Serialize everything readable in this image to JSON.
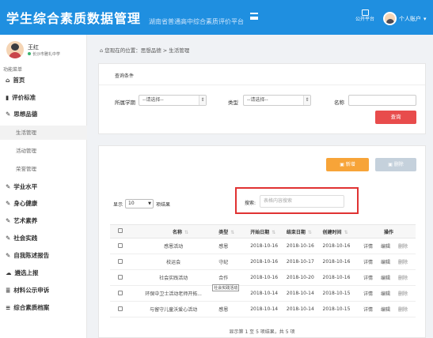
{
  "header": {
    "title": "学生综合素质数据管理",
    "subtitle": "湖南省普通高中综合素质评价平台",
    "public_label": "公开平台",
    "account_label": "个人账户"
  },
  "user": {
    "name": "王红",
    "school": "长沙市雅礼中学"
  },
  "sidebar": {
    "menu_title": "功能菜单",
    "items": [
      {
        "label": "首页",
        "icon": "home-icon"
      },
      {
        "label": "评价标准",
        "icon": "book-icon"
      },
      {
        "label": "思想品德",
        "icon": "edit-icon"
      },
      {
        "label": "学业水平",
        "icon": "edit-icon"
      },
      {
        "label": "身心健康",
        "icon": "edit-icon"
      },
      {
        "label": "艺术素养",
        "icon": "edit-icon"
      },
      {
        "label": "社会实践",
        "icon": "edit-icon"
      },
      {
        "label": "自我陈述报告",
        "icon": "edit-icon"
      },
      {
        "label": "遴选上报",
        "icon": "cloud-upload-icon"
      },
      {
        "label": "材料公示申诉",
        "icon": "list-icon"
      },
      {
        "label": "综合素质档案",
        "icon": "archive-icon"
      }
    ],
    "subitems": [
      "生活管理",
      "活动管理",
      "荣誉管理"
    ]
  },
  "breadcrumb": {
    "prefix": "您现在的位置：",
    "path": "思想品德 > 生活管理"
  },
  "query": {
    "title": "查询条件",
    "term_label": "所属学期",
    "term_value": "--请选择--",
    "type_label": "类型",
    "type_value": "--请选择--",
    "name_label": "名称",
    "name_value": "",
    "query_button": "查询"
  },
  "list": {
    "add_button": "新增",
    "delete_button": "删除",
    "show_label": "显示",
    "page_size": "10",
    "records_label": "项结果",
    "search_label": "搜索:",
    "search_placeholder": "表格内容搜索",
    "columns": [
      "名称",
      "类型",
      "开始日期",
      "结束日期",
      "创建时间",
      "操作"
    ],
    "rows": [
      {
        "name": "感恩活动",
        "type": "感恩",
        "start": "2018-10-16",
        "end": "2018-10-16",
        "created": "2018-10-16"
      },
      {
        "name": "校运会",
        "type": "守纪",
        "start": "2018-10-16",
        "end": "2018-10-17",
        "created": "2018-10-16"
      },
      {
        "name": "社会实践活动",
        "type": "合作",
        "start": "2018-10-16",
        "end": "2018-10-20",
        "created": "2018-10-16"
      },
      {
        "name": "环保中卫士活动老师开拓...",
        "type": "社会实践活动",
        "start": "2018-10-14",
        "end": "2018-10-14",
        "created": "2018-10-15"
      },
      {
        "name": "与留守儿童沃爱心活动",
        "type": "感恩",
        "start": "2018-10-14",
        "end": "2018-10-14",
        "created": "2018-10-15"
      }
    ],
    "tooltip": "社会实践活动",
    "actions": [
      "详情",
      "编辑",
      "删除"
    ],
    "info": "显示第 1 至 5 项结果，共 5 项"
  },
  "colors": {
    "primary": "#1f8fe0",
    "danger": "#e84c4c",
    "warning": "#f7a438",
    "disabled": "#c5d1dc",
    "highlight": "#e03232"
  }
}
